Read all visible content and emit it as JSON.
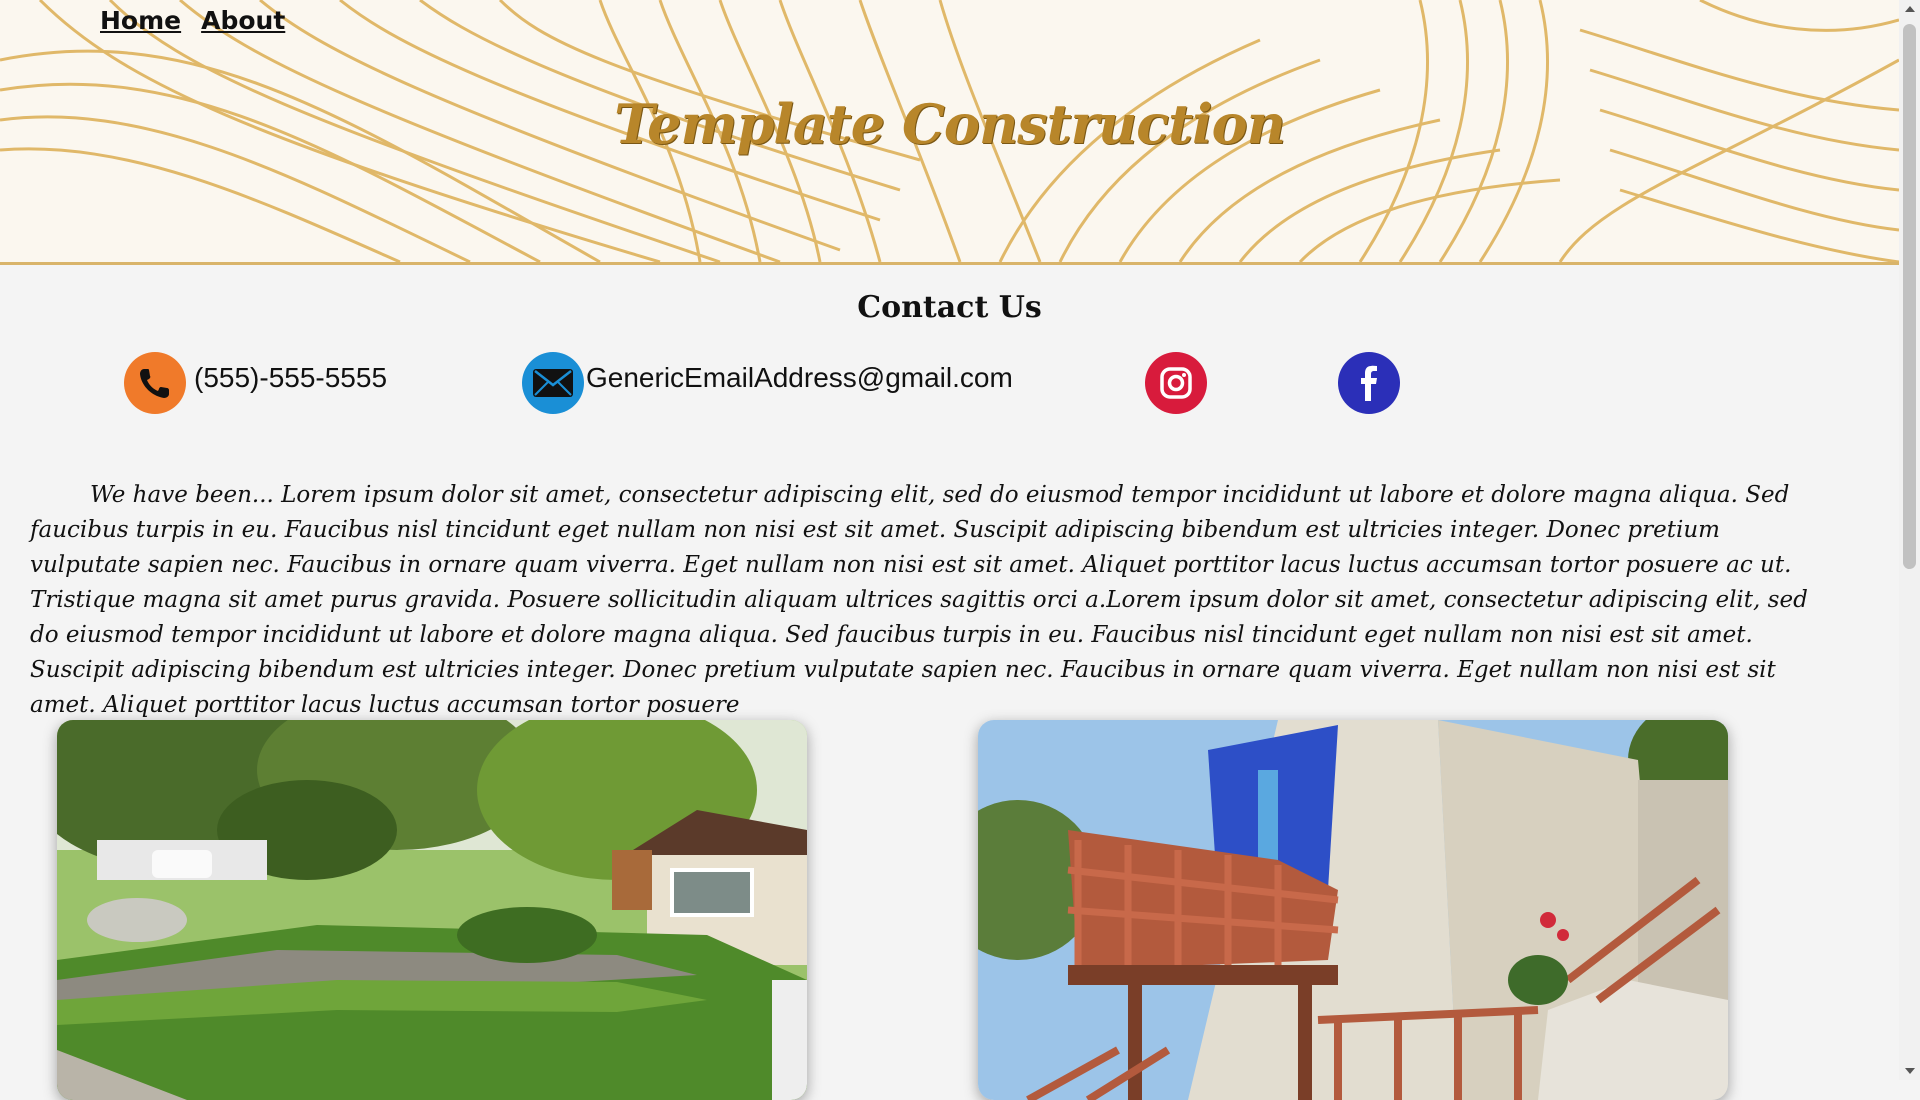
{
  "nav": {
    "home": "Home",
    "about": "About"
  },
  "site": {
    "title": "Template Construction"
  },
  "contact": {
    "heading": "Contact Us",
    "phone": "(555)-555-5555",
    "email": "GenericEmailAddress@gmail.com",
    "icons": [
      "phone-icon",
      "email-icon",
      "instagram-icon",
      "facebook-icon"
    ]
  },
  "about": {
    "text": "We have been... Lorem ipsum dolor sit amet, consectetur adipiscing elit, sed do eiusmod tempor incididunt ut labore et dolore magna aliqua. Sed faucibus turpis in eu. Faucibus nisl tincidunt eget nullam non nisi est sit amet. Suscipit adipiscing bibendum est ultricies integer. Donec pretium vulputate sapien nec. Faucibus in ornare quam viverra. Eget nullam non nisi est sit amet. Aliquet porttitor lacus luctus accumsan tortor posuere ac ut. Tristique magna sit amet purus gravida. Posuere sollicitudin aliquam ultrices sagittis orci a.Lorem ipsum dolor sit amet, consectetur adipiscing elit, sed do eiusmod tempor incididunt ut labore et dolore magna aliqua. Sed faucibus turpis in eu. Faucibus nisl tincidunt eget nullam non nisi est sit amet. Suscipit adipiscing bibendum est ultricies integer. Donec pretium vulputate sapien nec. Faucibus in ornare quam viverra. Eget nullam non nisi est sit amet. Aliquet porttitor lacus luctus accumsan tortor posuere"
  },
  "colors": {
    "banner_gold": "#d9a84a",
    "title_gold": "#b8862a",
    "phone_orange": "#f07a2a",
    "email_blue": "#1a8fd6",
    "instagram_red": "#d81b3c",
    "facebook_blue": "#2b2fb8",
    "page_bg": "#f4f4f4"
  },
  "photos": [
    "landscaped-yard-photo",
    "house-deck-photo"
  ]
}
